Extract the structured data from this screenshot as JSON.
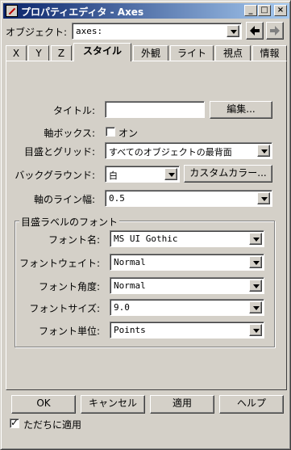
{
  "window": {
    "title": "プロパティエディタ - Axes"
  },
  "object": {
    "label": "オブジェクト:",
    "value": "axes:"
  },
  "tabs": [
    "X",
    "Y",
    "Z",
    "スタイル",
    "外観",
    "ライト",
    "視点",
    "情報"
  ],
  "style": {
    "title_label": "タイトル:",
    "title_value": "",
    "edit_button": "編集...",
    "box_label": "軸ボックス:",
    "box_option": "オン",
    "box_checked": false,
    "grid_label": "目盛とグリッド:",
    "grid_value": "すべてのオブジェクトの最背面",
    "bg_label": "バックグラウンド:",
    "bg_value": "白",
    "custom_color_button": "カスタムカラー...",
    "linewidth_label": "軸のライン幅:",
    "linewidth_value": "0.5"
  },
  "font_group": {
    "title": "目盛ラベルのフォント",
    "name_label": "フォント名:",
    "name_value": "MS UI Gothic",
    "weight_label": "フォントウェイト:",
    "weight_value": "Normal",
    "angle_label": "フォント角度:",
    "angle_value": "Normal",
    "size_label": "フォントサイズ:",
    "size_value": "9.0",
    "units_label": "フォント単位:",
    "units_value": "Points"
  },
  "buttons": {
    "ok": "OK",
    "cancel": "キャンセル",
    "apply": "適用",
    "help": "ヘルプ"
  },
  "apply_immediately": {
    "label": "ただちに適用",
    "checked": true
  }
}
